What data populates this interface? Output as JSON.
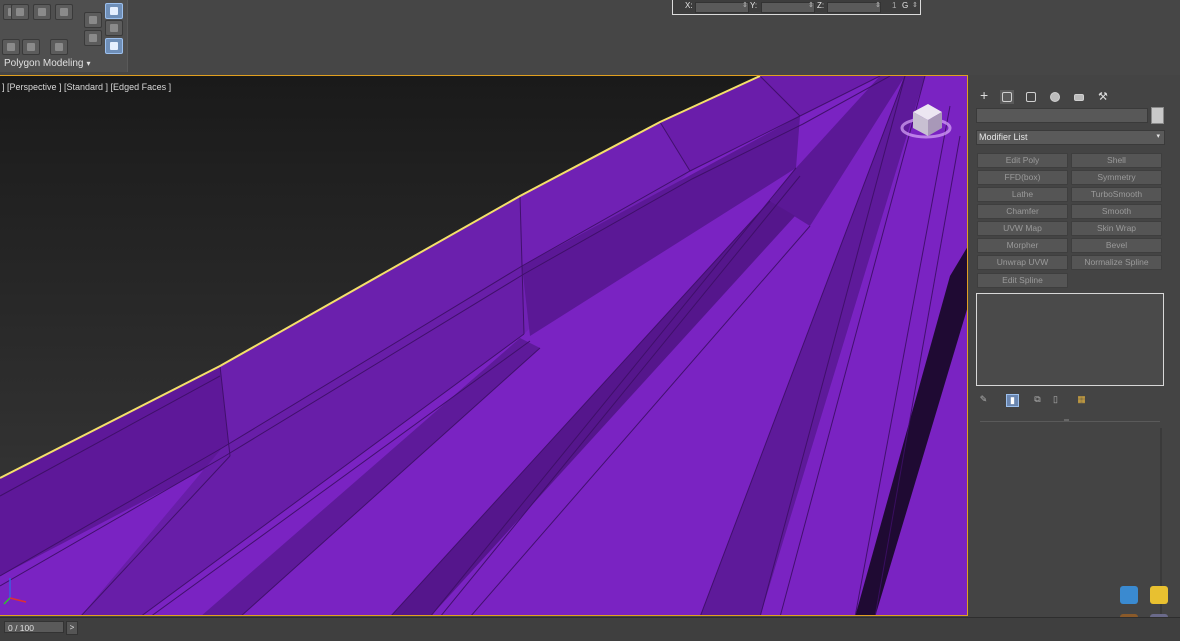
{
  "ribbon": {
    "tab_label": "Polygon Modeling",
    "dropdown_arrow": "▾"
  },
  "coordinates": {
    "x_label": "X:",
    "y_label": "Y:",
    "z_label": "Z:",
    "x_value": "",
    "y_value": "",
    "z_value": "",
    "spinner_glyph": "⇕",
    "g_label": "G",
    "g_index": "1"
  },
  "viewport": {
    "label": "] [Perspective ] [Standard ] [Edged Faces ]",
    "mesh_color": "#7a23c2",
    "mesh_dark": "#5b1896",
    "selection_edge_color": "#f4e06a",
    "active_border_color": "#e0a020"
  },
  "command_panel": {
    "tabs": [
      "create-icon",
      "modify-icon",
      "hierarchy-icon",
      "motion-icon",
      "display-icon",
      "utilities-icon"
    ],
    "active_tab": "modify-icon",
    "object_name": "",
    "modifier_list_label": "Modifier List",
    "modifier_list_arrow": "▾",
    "modifier_sets": {
      "left": [
        "Edit Poly",
        "FFD(box)",
        "Lathe",
        "Chamfer",
        "UVW Map",
        "Morpher",
        "Unwrap UVW",
        "Edit Spline"
      ],
      "right": [
        "Shell",
        "Symmetry",
        "TurboSmooth",
        "Smooth",
        "Skin Wrap",
        "Bevel",
        "Normalize Spline"
      ]
    },
    "stack_icons": [
      "pin-stack-icon",
      "show-end-result-icon",
      "make-unique-icon",
      "remove-modifier-icon",
      "configure-modifier-sets-icon"
    ],
    "rollout_grip": "═"
  },
  "timeline": {
    "frame_display": "0 / 100",
    "next_label": ">"
  }
}
